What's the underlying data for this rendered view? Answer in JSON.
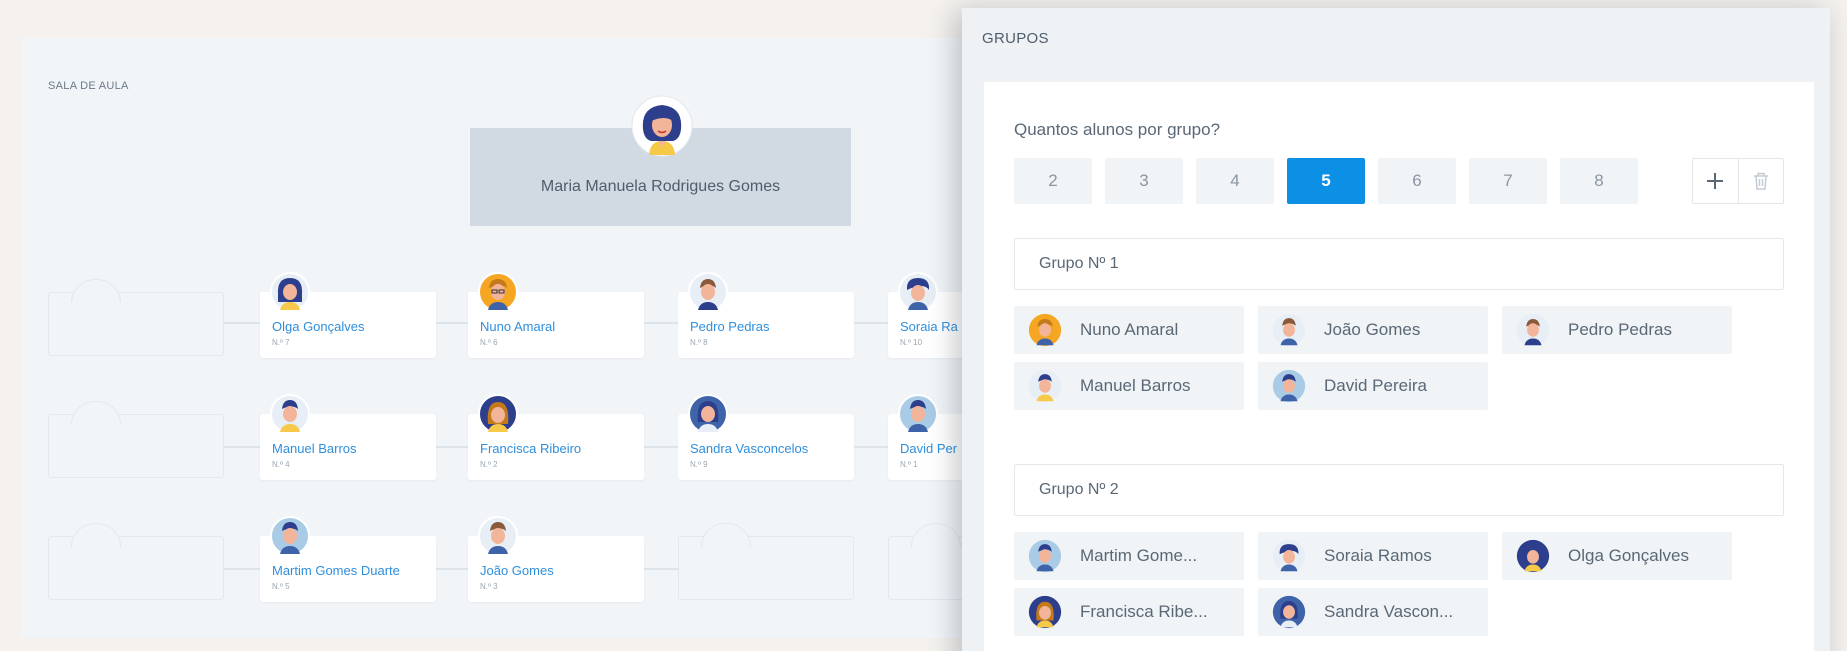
{
  "classroom": {
    "title": "SALA DE AULA",
    "teacher": "Maria Manuela Rodrigues Gomes",
    "seats": [
      {
        "name": "Olga Gonçalves",
        "number": "N.º 7"
      },
      {
        "name": "Nuno Amaral",
        "number": "N.º 6"
      },
      {
        "name": "Pedro Pedras",
        "number": "N.º 8"
      },
      {
        "name": "Soraia Ra",
        "number": "N.º 10"
      },
      {
        "name": "Manuel Barros",
        "number": "N.º 4"
      },
      {
        "name": "Francisca Ribeiro",
        "number": "N.º 2"
      },
      {
        "name": "Sandra Vasconcelos",
        "number": "N.º 9"
      },
      {
        "name": "David Per",
        "number": "N.º 1"
      },
      {
        "name": "Martim Gomes Duarte",
        "number": "N.º 5"
      },
      {
        "name": "João Gomes",
        "number": "N.º 3"
      }
    ]
  },
  "groups": {
    "title": "GRUPOS",
    "question": "Quantos alunos por grupo?",
    "sizes": [
      "2",
      "3",
      "4",
      "5",
      "6",
      "7",
      "8"
    ],
    "selected_size": "5",
    "add_icon": "plus-icon",
    "delete_icon": "trash-icon",
    "group1": {
      "label": "Grupo Nº 1",
      "members": [
        "Nuno Amaral",
        "João Gomes",
        "Pedro Pedras",
        "Manuel Barros",
        "David Pereira"
      ]
    },
    "group2": {
      "label": "Grupo Nº 2",
      "members": [
        "Martim Gome...",
        "Soraia Ramos",
        "Olga Gonçalves",
        "Francisca Ribe...",
        "Sandra Vascon..."
      ]
    }
  },
  "colors": {
    "accent": "#0b90e6",
    "student_name": "#2f8fdd",
    "teacher_desk": "#d1dae3"
  }
}
